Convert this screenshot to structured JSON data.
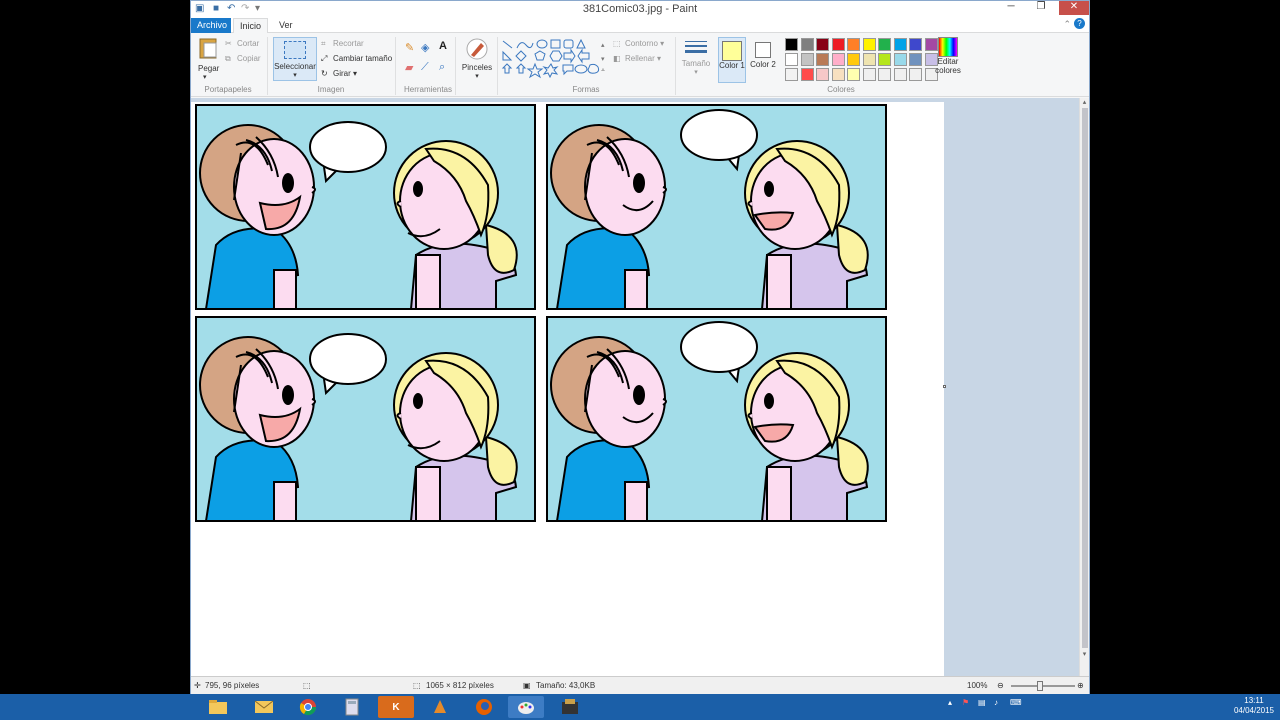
{
  "window": {
    "title": "381Comic03.jpg - Paint"
  },
  "tabs": [
    "Archivo",
    "Inicio",
    "Ver"
  ],
  "ribbon": {
    "clipboard": {
      "paste": "Pegar",
      "cut": "Cortar",
      "copy": "Copiar",
      "group": "Portapapeles"
    },
    "image": {
      "select": "Seleccionar",
      "crop": "Recortar",
      "resize": "Cambiar tamaño",
      "rotate": "Girar",
      "group": "Imagen"
    },
    "tools": {
      "group": "Herramientas",
      "brushes": "Pinceles"
    },
    "shapes": {
      "outline": "Contorno",
      "fill": "Rellenar",
      "group": "Formas"
    },
    "size": {
      "label": "Tamaño"
    },
    "colors": {
      "color1": "Color 1",
      "color2": "Color 2",
      "edit": "Editar colores",
      "group": "Colores",
      "color1_value": "#ffff99",
      "color2_value": "#ffffff",
      "palette_row1": [
        "#000000",
        "#7f7f7f",
        "#880015",
        "#ed1c24",
        "#ff7f27",
        "#fff200",
        "#22b14c",
        "#00a2e8",
        "#3f48cc",
        "#a349a4"
      ],
      "palette_row2": [
        "#ffffff",
        "#c3c3c3",
        "#b97a57",
        "#ffaec9",
        "#ffc90e",
        "#efe4b0",
        "#b5e61d",
        "#99d9ea",
        "#7092be",
        "#c8bfe7"
      ],
      "palette_row3": [
        "#f2f2f2",
        "#ff4b4b",
        "#f7c8c8",
        "#f7e0c0",
        "#ffffb0",
        "#f0f0f0",
        "#f0f0f0",
        "#f0f0f0",
        "#f0f0f0",
        "#f0f0f0"
      ]
    }
  },
  "status": {
    "cursor": "795, 96 píxeles",
    "dimensions": "1065 × 812 píxeles",
    "filesize": "Tamaño: 43,0KB",
    "zoom": "100%"
  },
  "taskbar": {
    "time": "13:11",
    "date": "04/04/2015"
  },
  "comic": {
    "sky": "#a3dde9",
    "boy_skin": "#fcdcf0",
    "boy_hair": "#d4a484",
    "boy_shirt": "#0c9fe5",
    "girl_hair": "#fbf3a3",
    "girl_shirt": "#d5c5ec"
  }
}
